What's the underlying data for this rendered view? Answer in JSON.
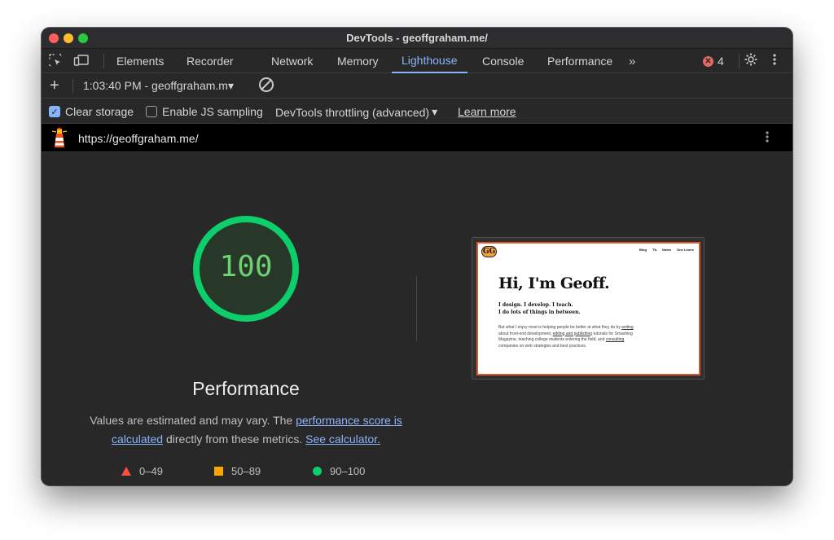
{
  "window": {
    "title": "DevTools - geoffgraham.me/"
  },
  "tabs": [
    {
      "label": "Elements"
    },
    {
      "label": "Recorder"
    },
    {
      "label": "Network"
    },
    {
      "label": "Memory"
    },
    {
      "label": "Lighthouse"
    },
    {
      "label": "Console"
    },
    {
      "label": "Performance"
    }
  ],
  "active_tab": "Lighthouse",
  "more_tabs": "»",
  "issues": {
    "count": "4",
    "icon": "error-icon"
  },
  "report_bar": {
    "add_label": "+",
    "report": "1:03:40 PM - geoffgraham.m",
    "caret": "▾"
  },
  "options": {
    "clear_storage": {
      "label": "Clear storage",
      "checked": true
    },
    "js_sampling": {
      "label": "Enable JS sampling",
      "checked": false
    },
    "throttling": "DevTools throttling (advanced)",
    "throttling_caret": "▾",
    "learn_more": "Learn more"
  },
  "url": "https://geoffgraham.me/",
  "report": {
    "score": "100",
    "score_fraction": 1.0,
    "category": "Performance",
    "desc_prefix": "Values are estimated and may vary. The ",
    "desc_link1": "performance score is calculated",
    "desc_middle": " directly from these metrics. ",
    "desc_link2": "See calculator.",
    "legend": [
      {
        "range": "0–49",
        "shape": "triangle",
        "color": "#ff4e42"
      },
      {
        "range": "50–89",
        "shape": "square",
        "color": "#ffa400"
      },
      {
        "range": "90–100",
        "shape": "circle",
        "color": "#0cce6b"
      }
    ]
  },
  "screenshot": {
    "logo": "GG",
    "nav": [
      "Blog",
      "TIL",
      "Notes",
      "One Liners"
    ],
    "heading": "Hi, I'm Geoff.",
    "tagline1": "I design. I develop. I teach.",
    "tagline2": "I do lots of things in between.",
    "body_a": "But what I enjoy most is helping people be better at what they do by ",
    "link_writing": "writing",
    "body_b": " about front-end development, ",
    "link_editing": "editing and publishing",
    "body_c": " tutorials for Smashing Magazine, teaching college students entering the field, and ",
    "link_consulting": "consulting",
    "body_d": " companies on web strategies and best practices."
  },
  "colors": {
    "accent": "#8ab4f8",
    "pass": "#0cce6b",
    "gauge_text": "#6fcf73"
  }
}
